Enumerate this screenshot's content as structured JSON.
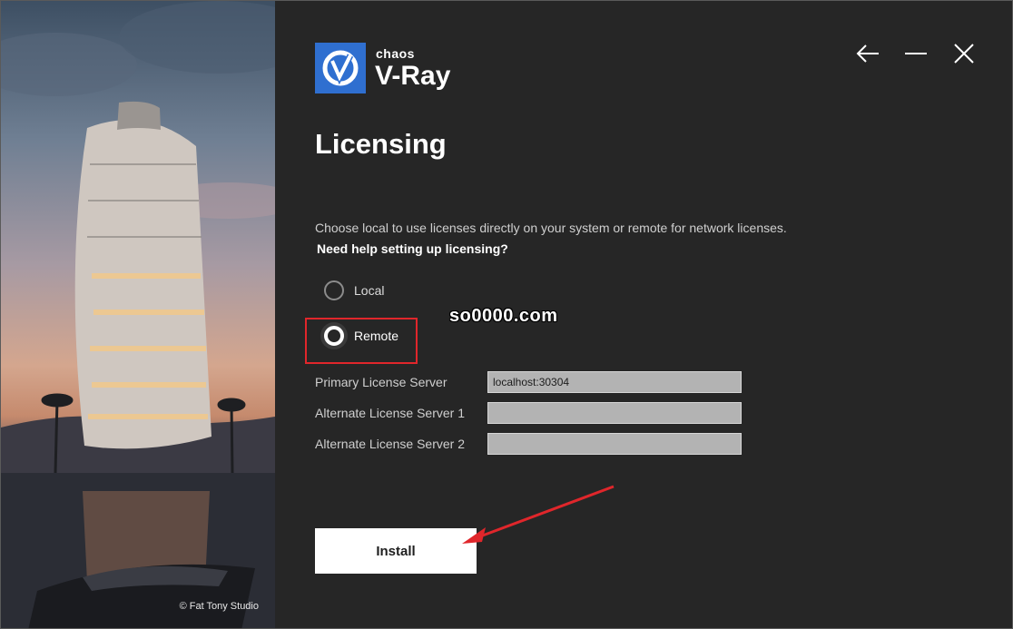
{
  "brand": {
    "small": "chaos",
    "big": "V-Ray",
    "accent": "#2f6fd0"
  },
  "page": {
    "title": "Licensing",
    "description": "Choose local to use licenses directly on your system or remote for network licenses.",
    "help_link": "Need help setting up licensing?"
  },
  "options": [
    {
      "label": "Local",
      "selected": false
    },
    {
      "label": "Remote",
      "selected": true
    }
  ],
  "fields": [
    {
      "label": "Primary License Server",
      "value": "localhost:30304"
    },
    {
      "label": "Alternate License Server 1",
      "value": ""
    },
    {
      "label": "Alternate License Server 2",
      "value": ""
    }
  ],
  "buttons": {
    "install": "Install"
  },
  "image": {
    "credit": "© Fat Tony Studio"
  },
  "annotation": {
    "watermark": "so0000.com",
    "highlight_color": "#e0262b"
  },
  "window_controls": [
    "back-icon",
    "minimize-icon",
    "close-icon"
  ]
}
